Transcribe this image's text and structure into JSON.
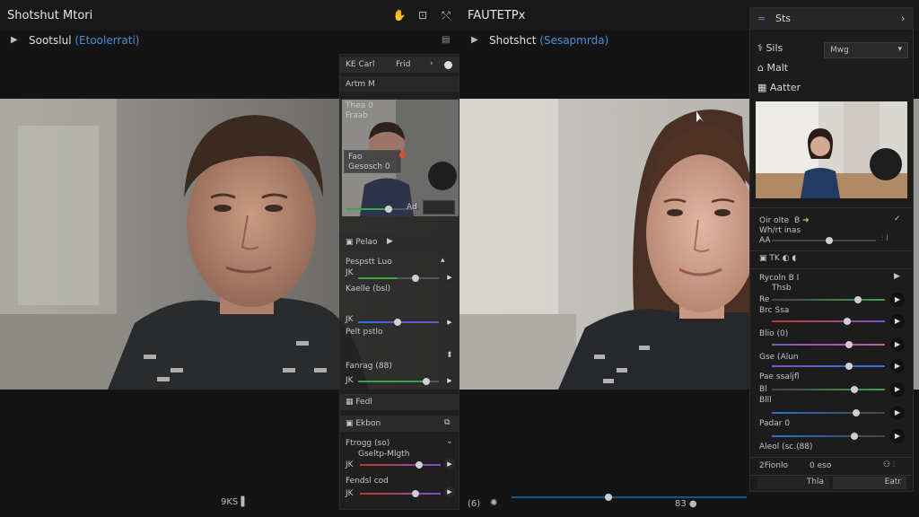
{
  "topbar": {
    "title_left": "Shotshut Mtori",
    "title_right": "FAUTETPx"
  },
  "subbar": {
    "left_label": "Sootslul",
    "left_label_blue": "(Etoolerrati)",
    "right_label": "Shotshct",
    "right_label_blue": "(Sesapmrda)"
  },
  "midpanel": {
    "head_a": "Carl",
    "head_a_prefix": "KE",
    "head_a_right": "Frid",
    "tab_label": "Artm M",
    "preview_label_1": "Thea 0",
    "preview_label_2": "Fraab",
    "chip_1": "Fao",
    "chip_2": "Gesosch 0",
    "preview_value": "Ad",
    "section_1": "Pelao",
    "row_1": "Pespstt Luo",
    "row_2": "Kaelle (bsl)",
    "row_3": "Pelt pstlo",
    "row_4": "Fanrag (88)",
    "section_2": "Fedl",
    "section_3": "Ekbon",
    "row_5": "Ftrogg (so)",
    "row_6": "Gseltp-Mlgth",
    "row_7": "Fendsl cod",
    "jk_1": "JK",
    "jk_2": "JK",
    "jk_3": "JK",
    "jk_4": "JK"
  },
  "rpanel": {
    "top_label": "Sts",
    "row_1": "Sils",
    "select_value": "Mwg",
    "row_2": "Malt",
    "row_3": "Aatter",
    "small_1": "Oir olte",
    "small_1b": "B",
    "small_2": "Wh/rt inas",
    "small_3": "AA",
    "section_tk": "TK",
    "s_row_1": "Rycoln",
    "s_row_1b": "B",
    "s_row_2": "Thsb",
    "s_row_3": "Re",
    "s_row_4": "Brc Ssa",
    "s_row_5": "Blio (0)",
    "s_row_6": "Gse (Alun",
    "s_row_7": "Pae ssaljfl",
    "s_row_8": "Bl",
    "s_row_9": "Blll",
    "s_row_10": "Padar 0",
    "s_row_11": "Aleol (sc.(88)",
    "bottom_1": "2Fionlo",
    "bottom_2": "0 eso",
    "footer_left": "Thla",
    "footer_right": "Eatr"
  },
  "bottom": {
    "left_count": "9KS",
    "mid_label": "(6)",
    "right_label": "83"
  },
  "colors": {
    "accent_blue": "#4c8fd6",
    "green": "#3fa34d",
    "red": "#c0392b",
    "purple": "#7e4fc6",
    "blue": "#2f6fcf",
    "pink": "#c45ca0"
  }
}
